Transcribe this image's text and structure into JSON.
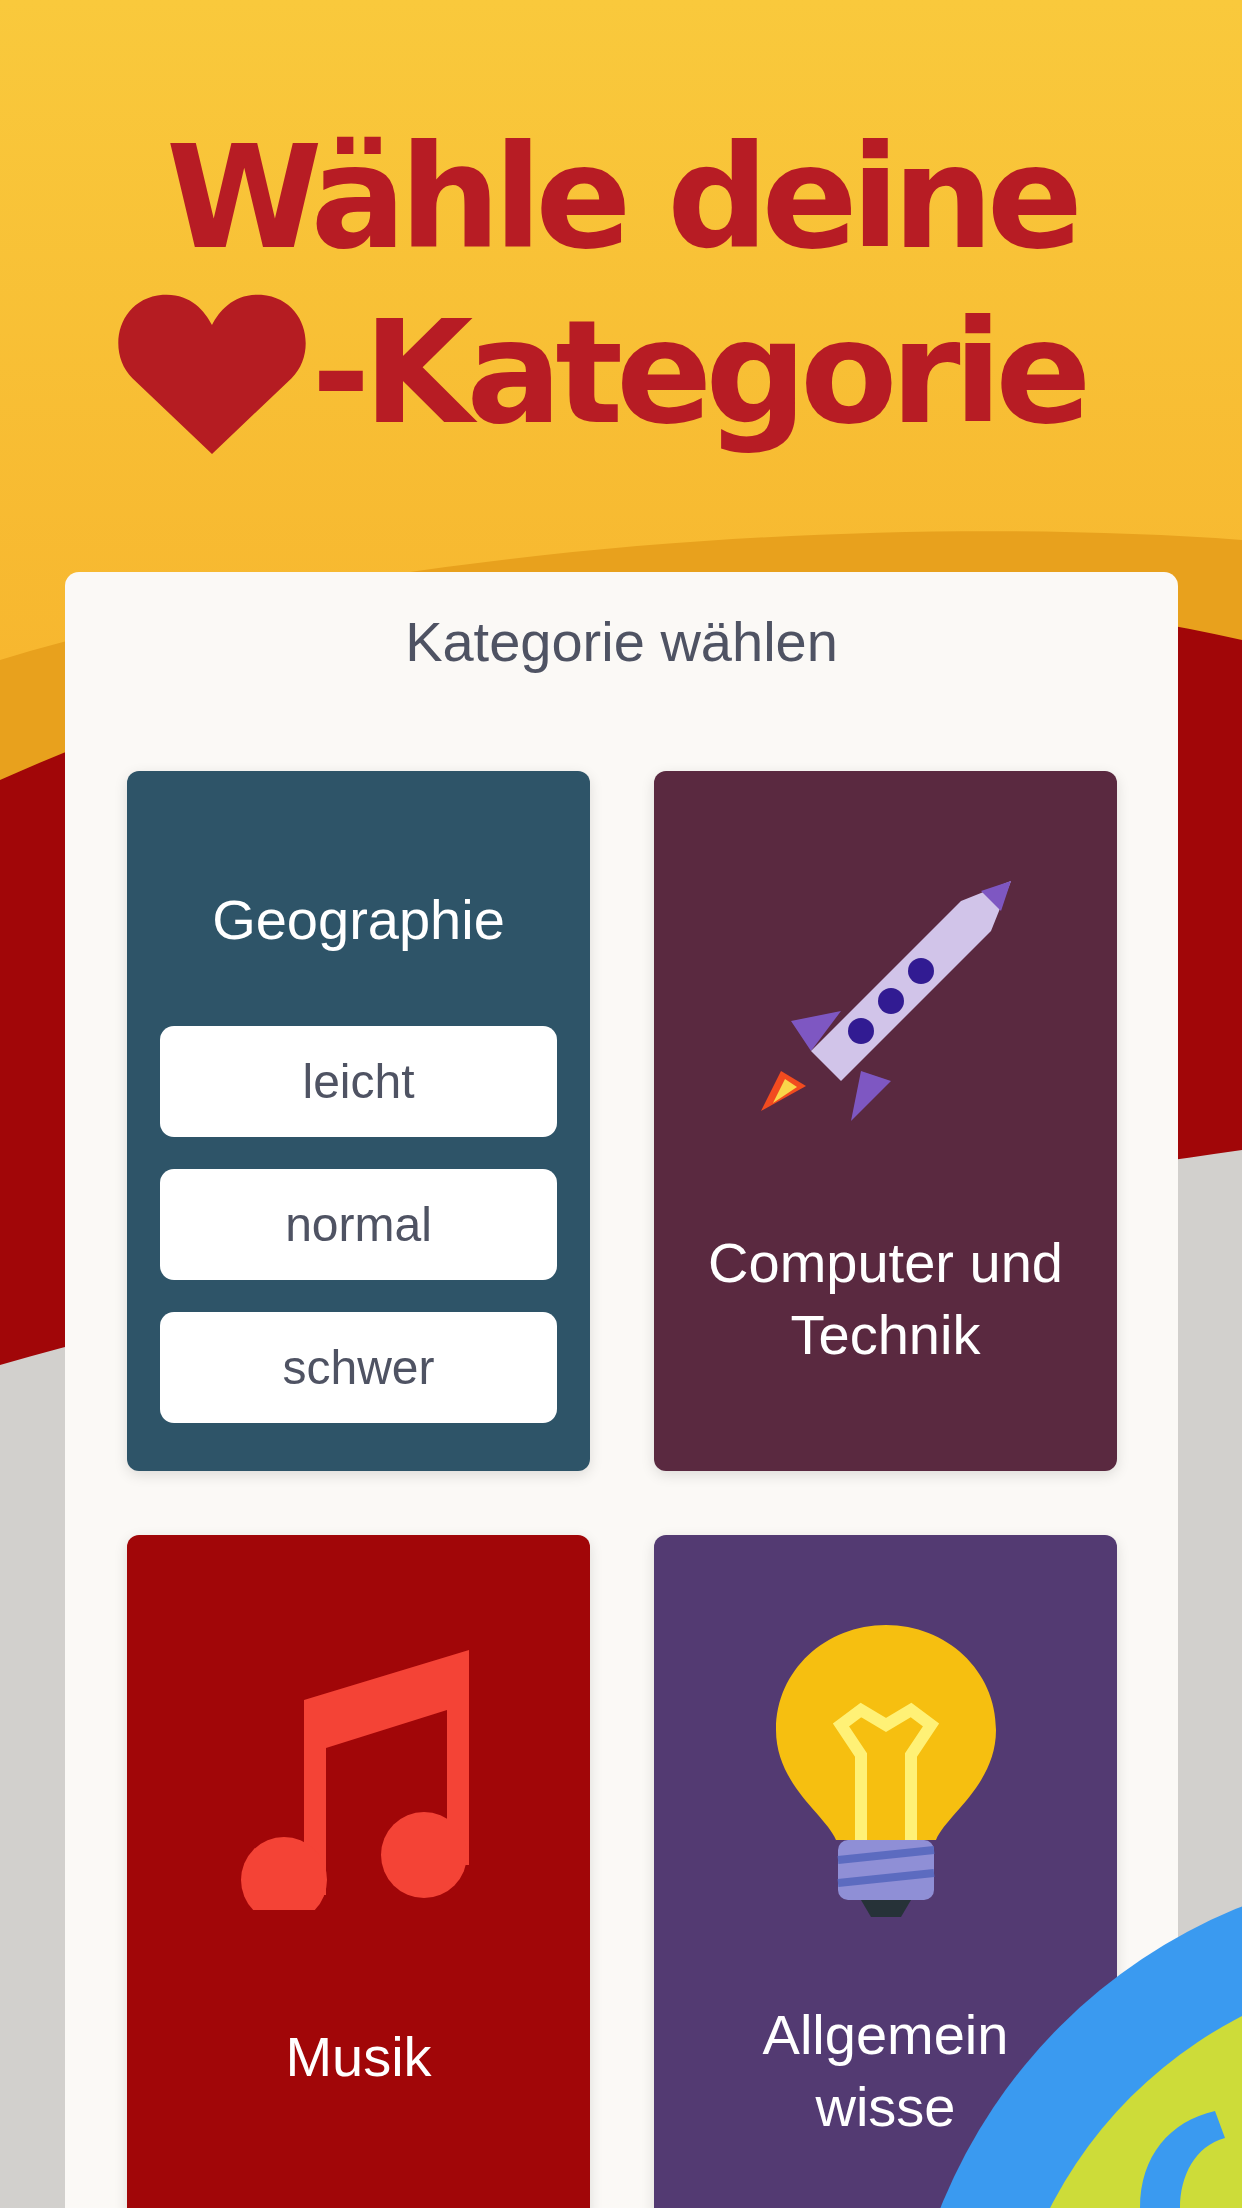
{
  "headline": {
    "line_1": "Wähle deine",
    "line_2": "-Kategorie"
  },
  "panel": {
    "title": "Kategorie wählen",
    "categories": [
      {
        "kind": "levels",
        "title_lines": [
          "Geographie"
        ],
        "color": "#2e5468",
        "levels": [
          "leicht",
          "normal",
          "schwer"
        ]
      },
      {
        "kind": "rocket",
        "title_lines": [
          "Computer und",
          "Technik"
        ],
        "color": "#5a2940"
      },
      {
        "kind": "music",
        "title_lines": [
          "Musik"
        ],
        "color": "#a10608"
      },
      {
        "kind": "bulb",
        "title_lines": [
          "Allgemein",
          "wisse"
        ],
        "color": "#533a72"
      }
    ]
  }
}
